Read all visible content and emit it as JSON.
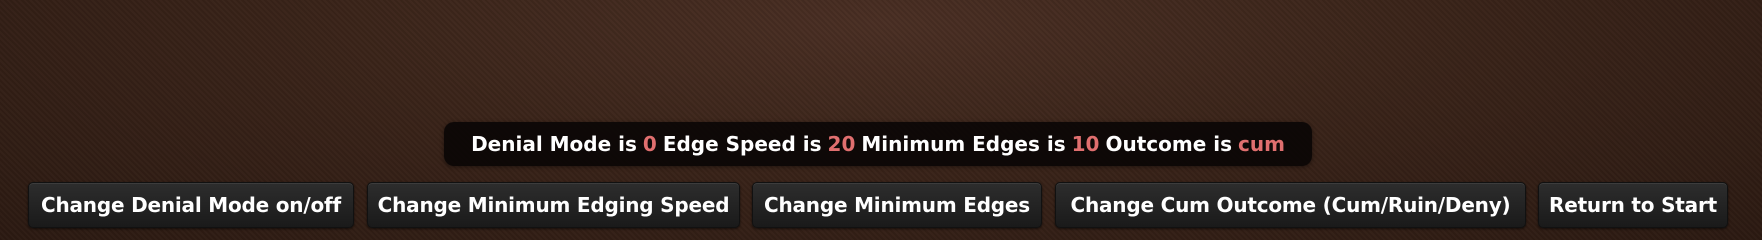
{
  "status": {
    "denial_label": "Denial Mode is",
    "denial_value": "0",
    "speed_label": "Edge Speed is",
    "speed_value": "20",
    "min_edges_label": "Minimum Edges is",
    "min_edges_value": "10",
    "outcome_label": "Outcome is",
    "outcome_value": "cum",
    "value_color": "#e06f6f"
  },
  "buttons": [
    {
      "label": "Change Denial Mode on/off"
    },
    {
      "label": "Change Minimum Edging Speed"
    },
    {
      "label": "Change Minimum Edges"
    },
    {
      "label": "Change Cum Outcome (Cum/Ruin/Deny)"
    },
    {
      "label": "Return to Start"
    }
  ]
}
